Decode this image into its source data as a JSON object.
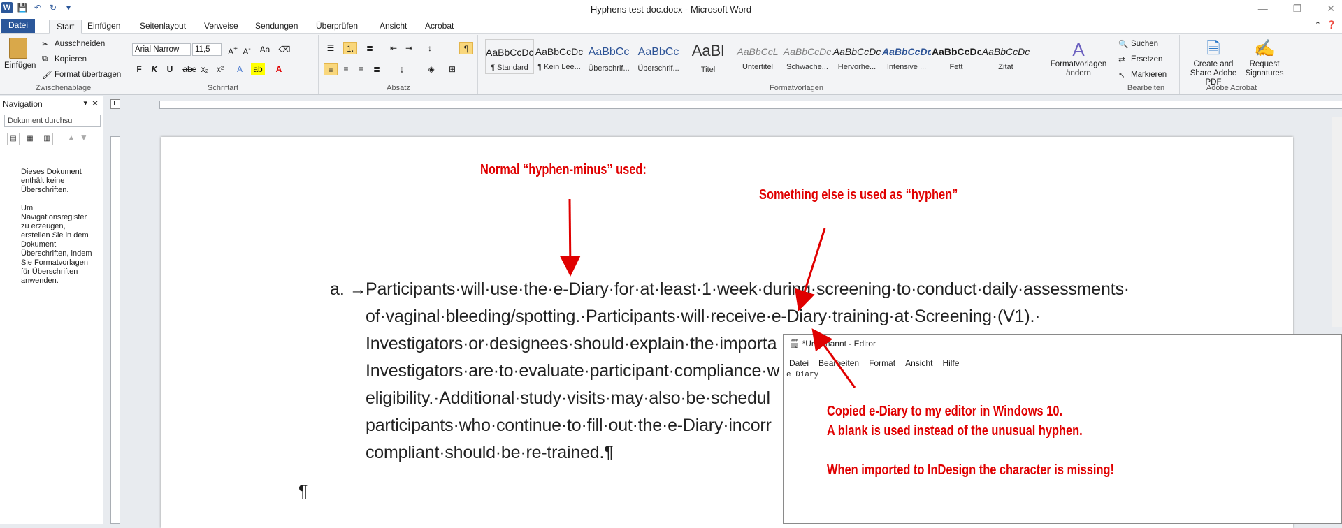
{
  "window": {
    "title": "Hyphens test doc.docx - Microsoft Word"
  },
  "tabs": [
    "Datei",
    "Start",
    "Einfügen",
    "Seitenlayout",
    "Verweise",
    "Sendungen",
    "Überprüfen",
    "Ansicht",
    "Acrobat"
  ],
  "ribbon": {
    "clipboard": {
      "paste": "Einfügen",
      "cut": "Ausschneiden",
      "copy": "Kopieren",
      "format_painter": "Format übertragen",
      "label": "Zwischenablage"
    },
    "font": {
      "name": "Arial Narrow",
      "size": "11,5",
      "label": "Schriftart"
    },
    "paragraph": {
      "label": "Absatz"
    },
    "styles": {
      "label": "Formatvorlagen",
      "items": [
        {
          "preview": "AaBbCcDc",
          "name": "¶ Standard"
        },
        {
          "preview": "AaBbCcDc",
          "name": "¶ Kein Lee..."
        },
        {
          "preview": "AaBbCc",
          "name": "Überschrif..."
        },
        {
          "preview": "AaBbCc",
          "name": "Überschrif..."
        },
        {
          "preview": "AaBl",
          "name": "Titel"
        },
        {
          "preview": "AaBbCcL",
          "name": "Untertitel"
        },
        {
          "preview": "AaBbCcDc",
          "name": "Schwache..."
        },
        {
          "preview": "AaBbCcDc",
          "name": "Hervorhe..."
        },
        {
          "preview": "AaBbCcDc",
          "name": "Intensive ..."
        },
        {
          "preview": "AaBbCcDc",
          "name": "Fett"
        },
        {
          "preview": "AaBbCcDc",
          "name": "Zitat"
        }
      ],
      "change": "Formatvorlagen ändern"
    },
    "editing": {
      "find": "Suchen",
      "replace": "Ersetzen",
      "select": "Markieren",
      "label": "Bearbeiten"
    },
    "acrobat": {
      "create": "Create and Share Adobe PDF",
      "request": "Request Signatures",
      "label": "Adobe Acrobat"
    }
  },
  "navigation": {
    "title": "Navigation",
    "search_placeholder": "Dokument durchsu",
    "message": "Dieses Dokument enthält keine Überschriften.\n\nUm Navigationsregister zu erzeugen, erstellen Sie in dem Dokument Überschriften, indem Sie Formatvorlagen für Überschriften anwenden."
  },
  "document": {
    "list_marker": "a. →",
    "lines": [
      "Participants·will·use·the·e-Diary·for·at·least·1·week·during·screening·to·conduct·daily·assessments·",
      "of·vaginal·bleeding/spotting.·Participants·will·receive·e‑Diary·training·at·Screening·(V1).·",
      "Investigators·or·designees·should·explain·the·importa",
      "Investigators·are·to·evaluate·participant·compliance·w",
      "eligibility.·Additional·study·visits·may·also·be·schedul",
      "participants·who·continue·to·fill·out·the·e-Diary·incorr",
      "compliant·should·be·re-trained.¶"
    ],
    "empty_para": "¶"
  },
  "annotations": {
    "normal": "Normal “hyphen-minus” used:",
    "other": "Something else is used as “hyphen”",
    "notepad_note_1": "Copied e-Diary to my editor in Windows 10.",
    "notepad_note_2": "A blank is used instead of the unusual hyphen.",
    "notepad_note_3": "When imported to InDesign the character is missing!"
  },
  "notepad": {
    "title": "*Unbenannt - Editor",
    "menu": [
      "Datei",
      "Bearbeiten",
      "Format",
      "Ansicht",
      "Hilfe"
    ],
    "content": "e Diary"
  },
  "colors": {
    "accent": "#2b579a",
    "annotation": "#e00000"
  }
}
